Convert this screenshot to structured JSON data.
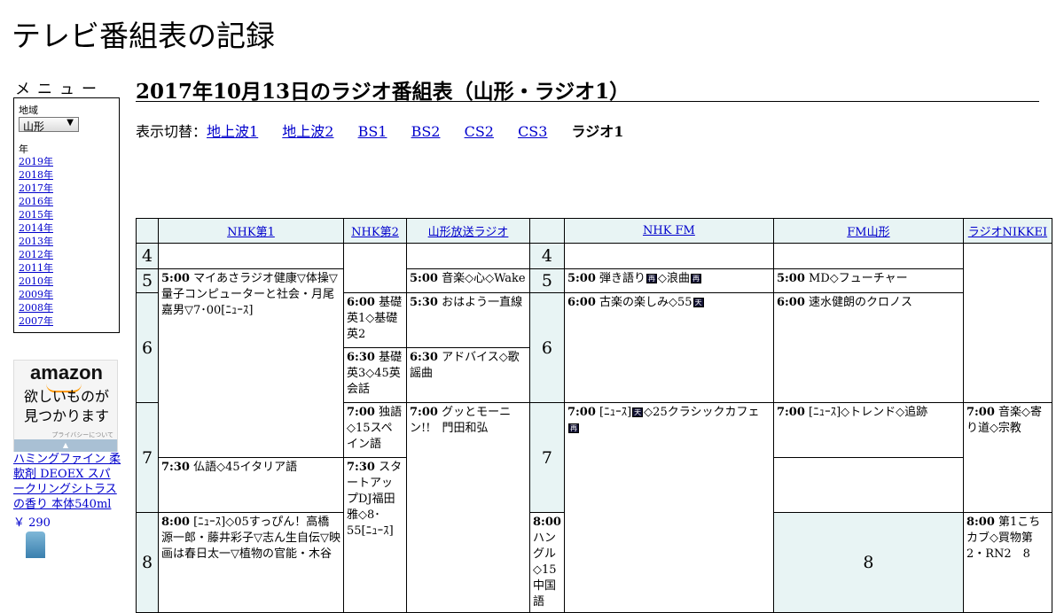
{
  "site": {
    "title": "テレビ番組表の記録"
  },
  "menu": {
    "title": "メニュー",
    "region_label": "地域",
    "region_value": "山形",
    "year_label": "年",
    "years": [
      "2019年",
      "2018年",
      "2017年",
      "2016年",
      "2015年",
      "2014年",
      "2013年",
      "2012年",
      "2011年",
      "2010年",
      "2009年",
      "2008年",
      "2007年"
    ]
  },
  "ad": {
    "logo": "amazon",
    "text_line1": "欲しいものが",
    "text_line2": "見つかります",
    "privacy": "プライバシーについて",
    "product": "ハミングファイン 柔軟剤 DEOEX スパークリングシトラスの香り 本体540ml",
    "price": "￥ 290"
  },
  "page": {
    "title": "2017年10月13日のラジオ番組表（山形・ラジオ1）"
  },
  "switcher": {
    "label": "表示切替：",
    "links": [
      "地上波1",
      "地上波2",
      "BS1",
      "BS2",
      "CS2",
      "CS3"
    ],
    "current": "ラジオ1"
  },
  "schedule": {
    "channels": [
      "NHK第1",
      "NHK第2",
      "山形放送ラジオ",
      "NHK FM",
      "FM山形",
      "ラジオNIKKEI"
    ],
    "hours": [
      "4",
      "5",
      "6",
      "7",
      "8"
    ],
    "programs": {
      "nhk1_0500": {
        "time": "5:00",
        "title": "マイあさラジオ健康▽体操▽量子コンピューターと社会・月尾嘉男▽7･00[ﾆｭｰｽ]"
      },
      "nhk1_0800": {
        "time": "8:00",
        "title": "[ﾆｭｰｽ]◇05すっぴん！高橋源一郎・藤井彩子▽志ん生自伝▽映画は春日太一▽植物の官能・木谷"
      },
      "nhk2_0600": {
        "time": "6:00",
        "title": "基礎英1◇基礎英2"
      },
      "nhk2_0630": {
        "time": "6:30",
        "title": "基礎英3◇45英会話"
      },
      "nhk2_0700": {
        "time": "7:00",
        "title": "独語◇15スペイン語"
      },
      "nhk2_0730": {
        "time": "7:30",
        "title": "仏語◇45イタリア語"
      },
      "nhk2_0800": {
        "time": "8:00",
        "title": "ハングル◇15中国語"
      },
      "ybc_0500": {
        "time": "5:00",
        "title": "音楽◇心◇Wake"
      },
      "ybc_0530": {
        "time": "5:30",
        "title": "おはよう一直線"
      },
      "ybc_0630": {
        "time": "6:30",
        "title": "アドバイス◇歌謡曲"
      },
      "ybc_0700": {
        "time": "7:00",
        "title": "グッとモーニン!!　門田和弘"
      },
      "fm_0500": {
        "time": "5:00",
        "title_a": "弾き語り",
        "icon_a": "再",
        "title_b": "◇浪曲",
        "icon_b": "再"
      },
      "fm_0600": {
        "time": "6:00",
        "title": "古楽の楽しみ◇55",
        "icon": "天"
      },
      "fm_0700": {
        "time": "7:00",
        "title_a": "[ﾆｭｰｽ]",
        "icon_a": "天",
        "title_b": "◇25クラシックカフェ",
        "icon_b": "再"
      },
      "fmy_0500": {
        "time": "5:00",
        "title": "MD◇フューチャー"
      },
      "fmy_0600": {
        "time": "6:00",
        "title": "速水健朗のクロノス"
      },
      "fmy_0700": {
        "time": "7:00",
        "title": "[ﾆｭｰｽ]◇トレンド◇追跡"
      },
      "fmy_0730": {
        "time": "7:30",
        "title": "スタートアップDJ福田雅◇8･55[ﾆｭｰｽ]"
      },
      "nikkei_0700": {
        "time": "7:00",
        "title": "音楽◇寄り道◇宗教"
      },
      "nikkei_0800": {
        "time": "8:00",
        "title": "第1こちカブ◇買物第2・RN2　8"
      }
    }
  }
}
